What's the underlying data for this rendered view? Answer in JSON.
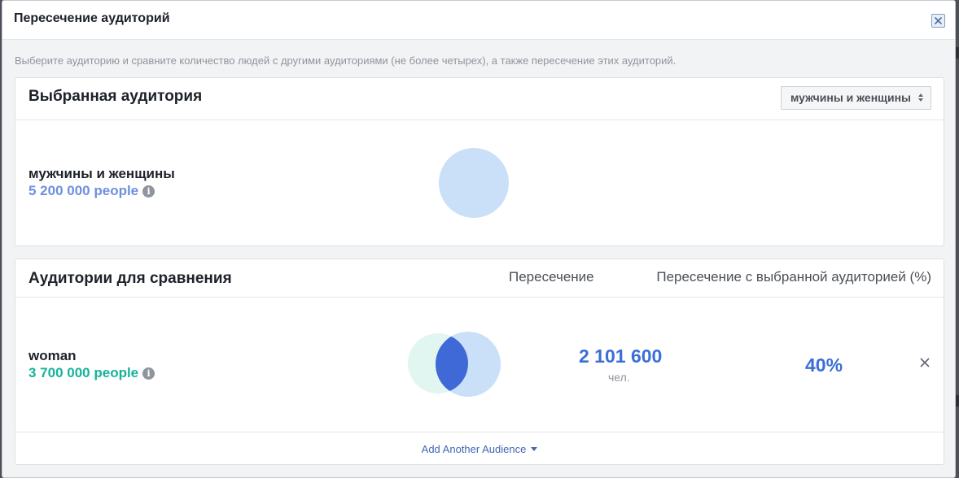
{
  "dialog": {
    "title": "Пересечение аудиторий",
    "hint": "Выберите аудиторию и сравните количество людей с другими аудиториями (не более четырех), а также пересечение этих аудиторий."
  },
  "selected": {
    "section_title": "Выбранная аудитория",
    "selector_value": "мужчины и женщины",
    "audience_name": "мужчины и женщины",
    "audience_count": "5 200 000 people"
  },
  "comparison": {
    "section_title": "Аудитории для сравнения",
    "col_overlap": "Пересечение",
    "col_overlap_pct": "Пересечение с выбранной аудиторией (%)",
    "rows": [
      {
        "name": "woman",
        "count": "3 700 000 people",
        "overlap_value": "2 101 600",
        "overlap_unit": "чел.",
        "overlap_pct": "40%"
      }
    ],
    "add_link": "Add Another Audience"
  },
  "colors": {
    "selected_count": "#6d8fe0",
    "compare_count": "#16b39a",
    "accent": "#3b6ed8",
    "circle_selected": "#c9e0f8",
    "circle_compare": "#dff6ef",
    "circle_overlap": "#3f69d6"
  },
  "icons": [
    "close-icon",
    "sort-arrows-icon",
    "info-icon",
    "remove-icon",
    "caret-down-icon"
  ]
}
